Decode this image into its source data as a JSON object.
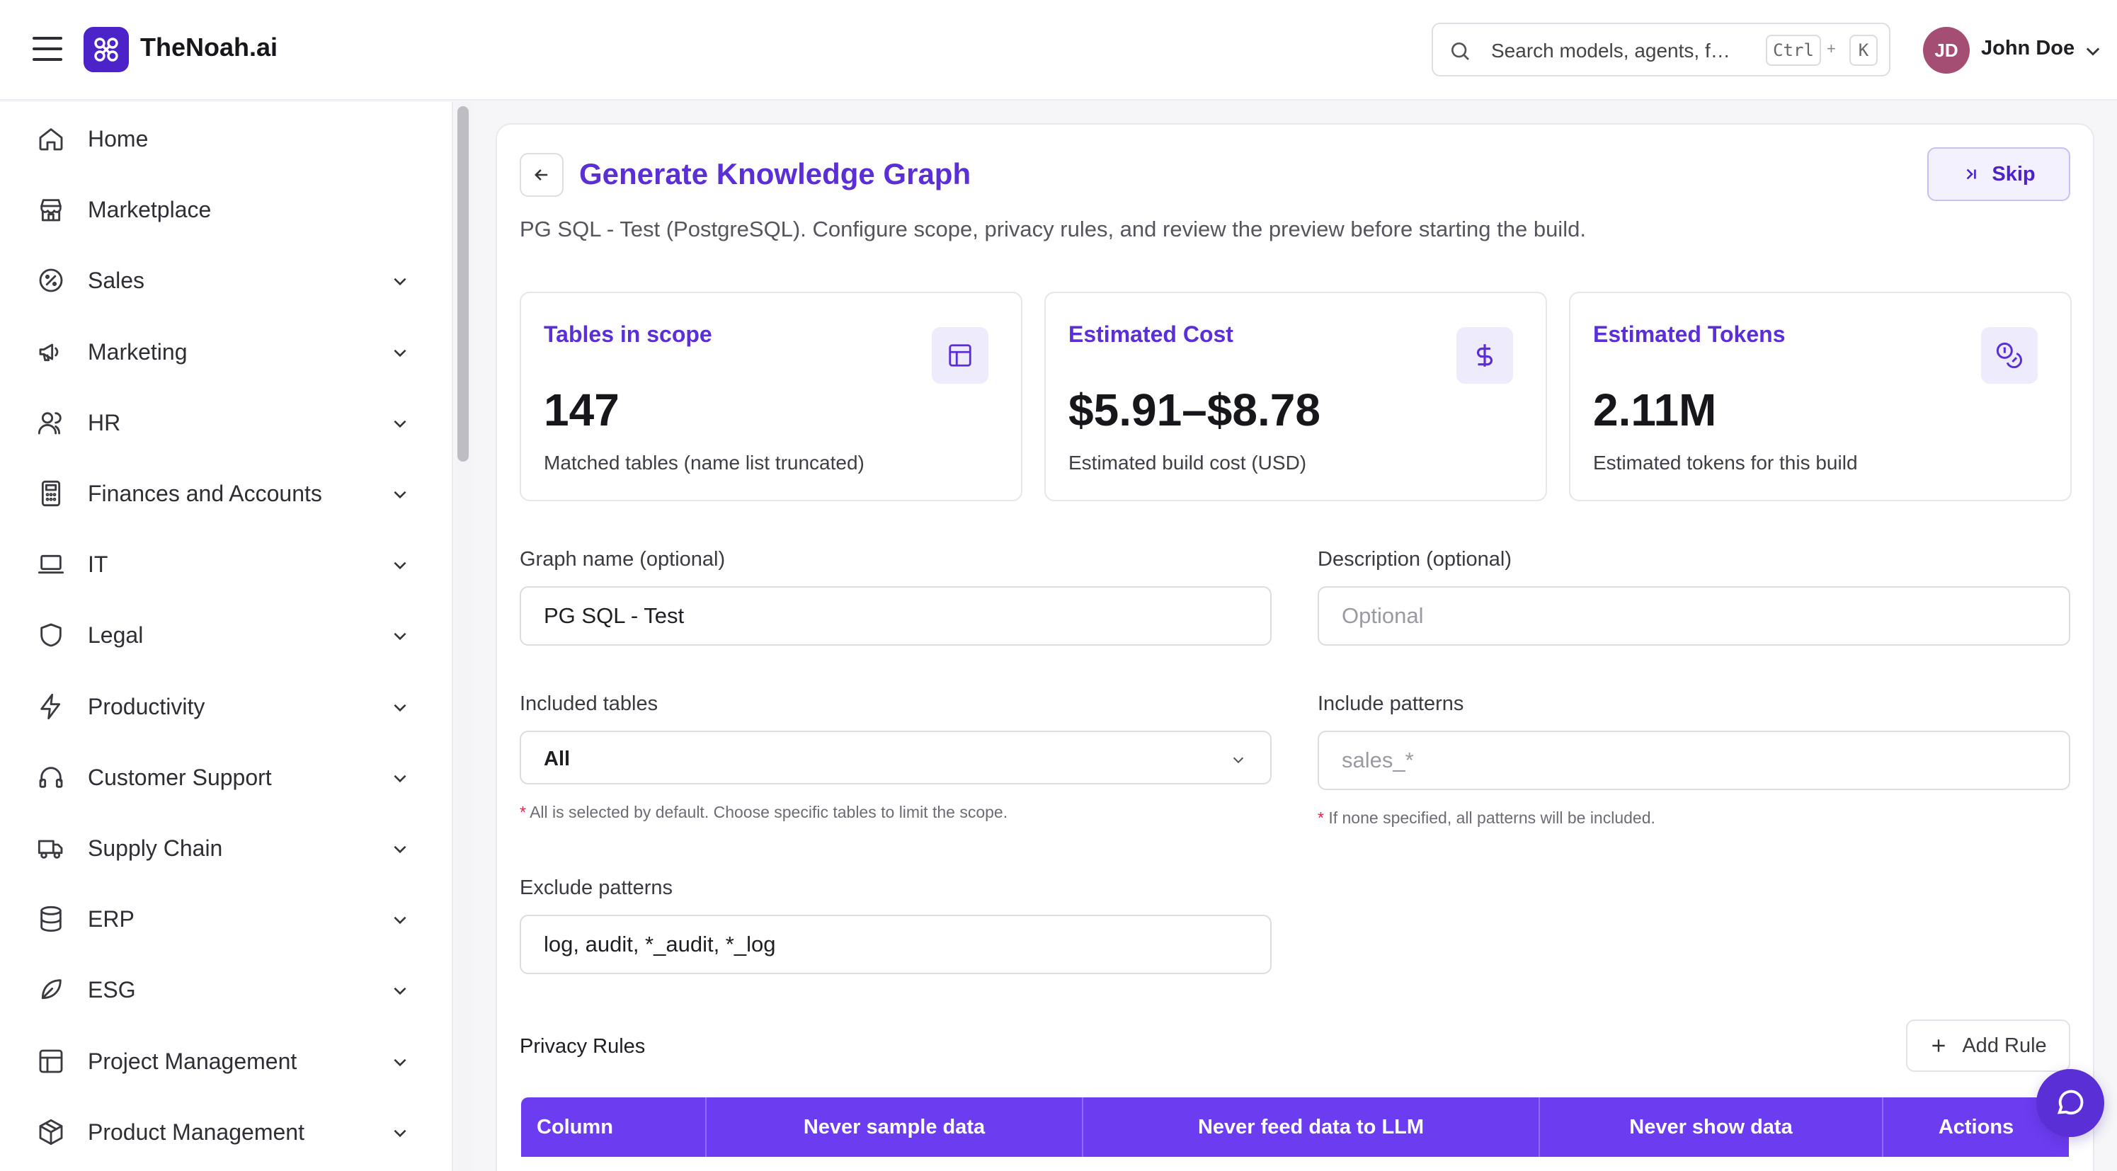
{
  "app": {
    "name": "TheNoah.ai"
  },
  "header": {
    "search_placeholder": "Search models, agents, f…",
    "shortcut_key1": "Ctrl",
    "shortcut_plus": "+",
    "shortcut_key2": "K",
    "user": {
      "initials": "JD",
      "name": "John Doe"
    }
  },
  "sidebar": {
    "items": [
      {
        "label": "Home",
        "icon": "home-icon"
      },
      {
        "label": "Marketplace",
        "icon": "store-icon"
      },
      {
        "label": "Sales",
        "icon": "badge-percent-icon",
        "expandable": true
      },
      {
        "label": "Marketing",
        "icon": "megaphone-icon",
        "expandable": true
      },
      {
        "label": "HR",
        "icon": "users-icon",
        "expandable": true
      },
      {
        "label": "Finances and Accounts",
        "icon": "calculator-icon",
        "expandable": true
      },
      {
        "label": "IT",
        "icon": "laptop-icon",
        "expandable": true
      },
      {
        "label": "Legal",
        "icon": "shield-icon",
        "expandable": true
      },
      {
        "label": "Productivity",
        "icon": "lightning-icon",
        "expandable": true
      },
      {
        "label": "Customer Support",
        "icon": "headset-icon",
        "expandable": true
      },
      {
        "label": "Supply Chain",
        "icon": "truck-icon",
        "expandable": true
      },
      {
        "label": "ERP",
        "icon": "database-icon",
        "expandable": true
      },
      {
        "label": "ESG",
        "icon": "leaf-icon",
        "expandable": true
      },
      {
        "label": "Project Management",
        "icon": "layout-icon",
        "expandable": true
      },
      {
        "label": "Product Management",
        "icon": "package-icon",
        "expandable": true
      }
    ]
  },
  "page": {
    "title": "Generate Knowledge Graph",
    "skip_label": "Skip",
    "subtitle": "PG SQL - Test (PostgreSQL). Configure scope, privacy rules, and review the preview before starting the build."
  },
  "stats": [
    {
      "title": "Tables in scope",
      "value": "147",
      "desc": "Matched tables (name list truncated)",
      "icon": "table-icon"
    },
    {
      "title": "Estimated Cost",
      "value": "$5.91–$8.78",
      "desc": "Estimated build cost (USD)",
      "icon": "dollar-icon"
    },
    {
      "title": "Estimated Tokens",
      "value": "2.11M",
      "desc": "Estimated tokens for this build",
      "icon": "coins-icon"
    }
  ],
  "form": {
    "graph_name_label": "Graph name (optional)",
    "graph_name_value": "PG SQL - Test",
    "description_label": "Description (optional)",
    "description_placeholder": "Optional",
    "included_tables_label": "Included tables",
    "included_tables_value": "All",
    "included_tables_hint": "All is selected by default. Choose specific tables to limit the scope.",
    "include_patterns_label": "Include patterns",
    "include_patterns_placeholder": "sales_*",
    "include_patterns_hint": "If none specified, all patterns will be included.",
    "exclude_patterns_label": "Exclude patterns",
    "exclude_patterns_value": "log, audit, *_audit, *_log",
    "required_marker": "*"
  },
  "privacy": {
    "title": "Privacy Rules",
    "add_rule_label": "Add Rule",
    "columns": [
      "Column",
      "Never sample data",
      "Never feed data to LLM",
      "Never show data",
      "Actions"
    ]
  },
  "colors": {
    "accent": "#5b2fd6",
    "table_header": "#6c3cf0",
    "avatar": "#a34e72",
    "required": "#e0264a"
  }
}
